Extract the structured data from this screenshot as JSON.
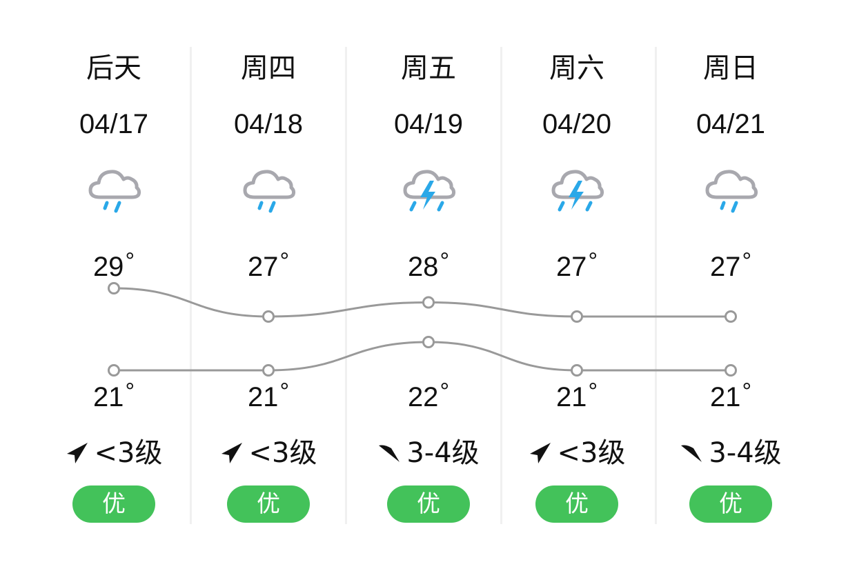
{
  "colors": {
    "aqi_good": "#43c25a",
    "line": "#999999",
    "rain": "#2aa8e8",
    "cloud": "#a8a8ae"
  },
  "days": [
    {
      "day": "后天",
      "date": "04/17",
      "icon": "rain-cloud-icon",
      "high": "29",
      "low": "21",
      "wind_dir": "northeast",
      "wind": "<3级",
      "aqi": "优"
    },
    {
      "day": "周四",
      "date": "04/18",
      "icon": "rain-cloud-icon",
      "high": "27",
      "low": "21",
      "wind_dir": "northeast",
      "wind": "<3级",
      "aqi": "优"
    },
    {
      "day": "周五",
      "date": "04/19",
      "icon": "thunderstorm-icon",
      "high": "28",
      "low": "22",
      "wind_dir": "southeast",
      "wind": "3-4级",
      "aqi": "优"
    },
    {
      "day": "周六",
      "date": "04/20",
      "icon": "thunderstorm-icon",
      "high": "27",
      "low": "21",
      "wind_dir": "northeast",
      "wind": "<3级",
      "aqi": "优"
    },
    {
      "day": "周日",
      "date": "04/21",
      "icon": "rain-cloud-icon",
      "high": "27",
      "low": "21",
      "wind_dir": "southeast",
      "wind": "3-4级",
      "aqi": "优"
    }
  ],
  "degree_symbol": "°",
  "chart_data": {
    "type": "line",
    "x": [
      "04/17",
      "04/18",
      "04/19",
      "04/20",
      "04/21"
    ],
    "series": [
      {
        "name": "high",
        "values": [
          29,
          27,
          28,
          27,
          27
        ]
      },
      {
        "name": "low",
        "values": [
          21,
          21,
          22,
          21,
          21
        ]
      }
    ]
  }
}
